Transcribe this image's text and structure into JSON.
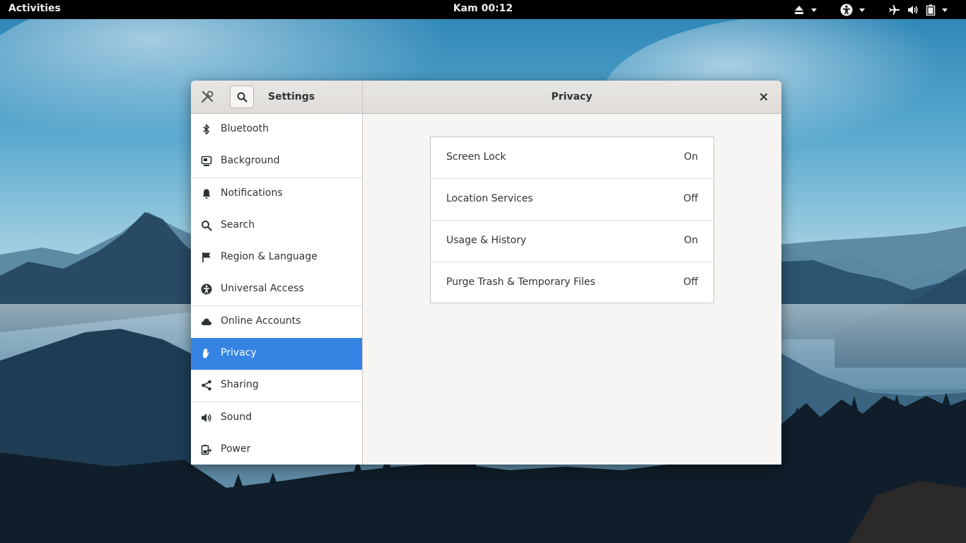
{
  "topbar": {
    "activities": "Activities",
    "clock": "Kam 00:12",
    "icons": [
      "eject-icon",
      "chevron-down-icon",
      "accessibility-icon",
      "chevron-down-icon",
      "airplane-icon",
      "volume-icon",
      "battery-icon",
      "chevron-down-icon"
    ]
  },
  "window": {
    "sidebar_title": "Settings",
    "panel_title": "Privacy",
    "sidebar": {
      "items": [
        {
          "label": "Bluetooth",
          "icon": "bluetooth-icon"
        },
        {
          "label": "Background",
          "icon": "background-icon"
        },
        {
          "label": "Notifications",
          "icon": "bell-icon"
        },
        {
          "label": "Search",
          "icon": "search-icon"
        },
        {
          "label": "Region & Language",
          "icon": "flag-icon"
        },
        {
          "label": "Universal Access",
          "icon": "accessibility-icon"
        },
        {
          "label": "Online Accounts",
          "icon": "cloud-icon"
        },
        {
          "label": "Privacy",
          "icon": "hand-icon",
          "selected": true
        },
        {
          "label": "Sharing",
          "icon": "share-icon"
        },
        {
          "label": "Sound",
          "icon": "speaker-icon"
        },
        {
          "label": "Power",
          "icon": "power-icon"
        }
      ]
    },
    "privacy": {
      "rows": [
        {
          "name": "Screen Lock",
          "value": "On"
        },
        {
          "name": "Location Services",
          "value": "Off"
        },
        {
          "name": "Usage & History",
          "value": "On"
        },
        {
          "name": "Purge Trash & Temporary Files",
          "value": "Off"
        }
      ]
    }
  },
  "colors": {
    "accent": "#3584e4",
    "topbar": "#000000",
    "window_bg": "#f6f5f4"
  }
}
